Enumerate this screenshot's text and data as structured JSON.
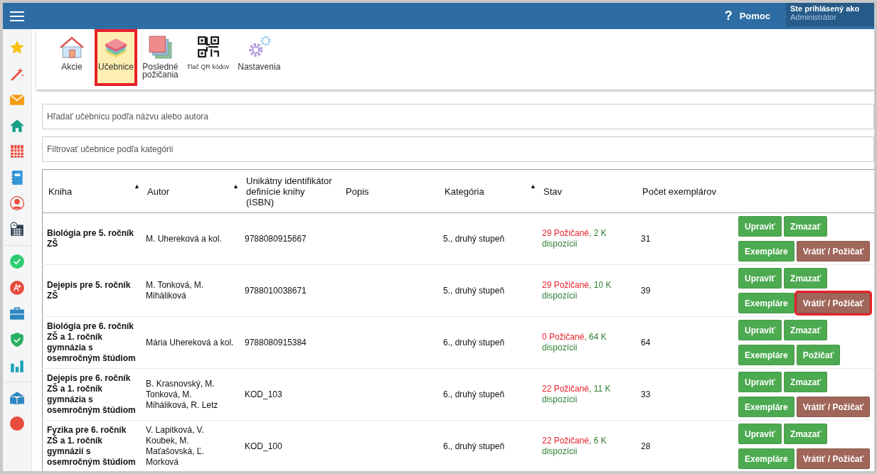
{
  "topbar": {
    "help_icon": "?",
    "help_label": "Pomoc",
    "user_caption": "Ste prihlásený ako",
    "user_name": "Administrátor"
  },
  "toolbar": [
    {
      "label": "Akcie",
      "kind": "house",
      "selected": false,
      "highlighted": false
    },
    {
      "label": "Učebnice",
      "kind": "stack",
      "selected": true,
      "highlighted": true
    },
    {
      "label": "Posledné požičania",
      "kind": "sheets",
      "selected": false,
      "highlighted": false
    },
    {
      "label": "Tlač QR kódov",
      "kind": "qr",
      "selected": false,
      "highlighted": false
    },
    {
      "label": "Nastavenia",
      "kind": "gears",
      "selected": false,
      "highlighted": false
    }
  ],
  "search": {
    "placeholder": "Hľadať učebnicu podľa názvu alebo autora"
  },
  "filter": {
    "placeholder": "Filtrovať učebnice podľa kategórii"
  },
  "table": {
    "columns": [
      {
        "label": "Kniha",
        "sort_indicator": "▲"
      },
      {
        "label": "Autor",
        "sort_indicator": "▲"
      },
      {
        "label": "Unikátny identifikátor definície knihy (ISBN)"
      },
      {
        "label": "Popis"
      },
      {
        "label": "Kategória",
        "sort_indicator": "▲"
      },
      {
        "label": "Stav"
      },
      {
        "label": "Počet exemplárov"
      }
    ],
    "rows": [
      {
        "book": "Biológia pre 5. ročník ZŠ",
        "author": "M. Uhereková a kol.",
        "isbn": "9788080915667",
        "category": "5., druhý stupeň",
        "borrowed": "29 Požičané",
        "available": ", 2 K dispozícii",
        "count": "31",
        "actions": [
          {
            "label": "Upraviť",
            "kind": "edit",
            "highlighted": false
          },
          {
            "label": "Zmazať",
            "kind": "delete",
            "highlighted": false
          },
          {
            "label": "Exempláre",
            "kind": "copies",
            "highlighted": false
          },
          {
            "label": "Vrátiť / Požičať",
            "kind": "return",
            "highlighted": false
          }
        ]
      },
      {
        "book": "Dejepis pre 5. ročník ZŠ",
        "author": "M. Tonková, M. Miháliková",
        "isbn": "9788010038671",
        "category": "5., druhý stupeň",
        "borrowed": "29 Požičané",
        "available": ", 10 K dispozícii",
        "count": "39",
        "actions": [
          {
            "label": "Upraviť",
            "kind": "edit",
            "highlighted": false
          },
          {
            "label": "Zmazať",
            "kind": "delete",
            "highlighted": false
          },
          {
            "label": "Exempláre",
            "kind": "copies",
            "highlighted": false
          },
          {
            "label": "Vrátiť / Požičať",
            "kind": "return",
            "highlighted": true
          }
        ]
      },
      {
        "book": "Biológia pre 6. ročník ZŠ a 1. ročník gymnázia s osemročným štúdiom",
        "author": "Mária Uhereková a kol.",
        "isbn": "9788080915384",
        "category": "6., druhý stupeň",
        "borrowed": "0 Požičané",
        "available": ", 64 K dispozícii",
        "count": "64",
        "actions": [
          {
            "label": "Upraviť",
            "kind": "edit",
            "highlighted": false
          },
          {
            "label": "Zmazať",
            "kind": "delete",
            "highlighted": false
          },
          {
            "label": "Exempláre",
            "kind": "copies",
            "highlighted": false
          },
          {
            "label": "Požičať",
            "kind": "lend",
            "highlighted": false
          }
        ]
      },
      {
        "book": "Dejepis pre 6. ročník ZŠ a 1. ročník gymnázia s osemročným štúdiom",
        "author": "B. Krasnovský, M. Tonková, M. Miháliková, R. Letz",
        "isbn": "KOD_103",
        "category": "6., druhý stupeň",
        "borrowed": "22 Požičané",
        "available": ", 11 K dispozícii",
        "count": "33",
        "actions": [
          {
            "label": "Upraviť",
            "kind": "edit",
            "highlighted": false
          },
          {
            "label": "Zmazať",
            "kind": "delete",
            "highlighted": false
          },
          {
            "label": "Exempláre",
            "kind": "copies",
            "highlighted": false
          },
          {
            "label": "Vrátiť / Požičať",
            "kind": "return",
            "highlighted": false
          }
        ]
      },
      {
        "book": "Fyzika pre 6. ročník ZŠ a 1. ročník gymnázií s osemročným štúdiom",
        "author": "V. Lapitková, V. Koubek, M. Maťašovská, Ľ. Morková",
        "isbn": "KOD_100",
        "category": "6., druhý stupeň",
        "borrowed": "22 Požičané",
        "available": ", 6 K dispozícii",
        "count": "28",
        "actions": [
          {
            "label": "Upraviť",
            "kind": "edit",
            "highlighted": false
          },
          {
            "label": "Zmazať",
            "kind": "delete",
            "highlighted": false
          },
          {
            "label": "Exempláre",
            "kind": "copies",
            "highlighted": false
          },
          {
            "label": "Vrátiť / Požičať",
            "kind": "return",
            "highlighted": false
          }
        ]
      }
    ]
  }
}
